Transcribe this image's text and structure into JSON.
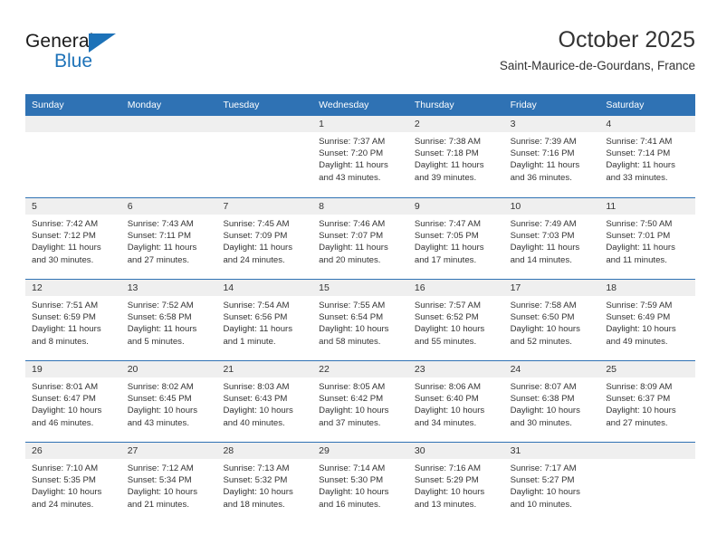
{
  "branding": {
    "name_part1": "General",
    "name_part2": "Blue"
  },
  "header": {
    "title": "October 2025",
    "location": "Saint-Maurice-de-Gourdans, France"
  },
  "weekdays": [
    "Sunday",
    "Monday",
    "Tuesday",
    "Wednesday",
    "Thursday",
    "Friday",
    "Saturday"
  ],
  "colors": {
    "header_blue": "#2f72b4",
    "logo_blue": "#1d72b8",
    "day_band_gray": "#efefef"
  },
  "weeks": [
    [
      {
        "day": "",
        "sunrise": "",
        "sunset": "",
        "daylight_line1": "",
        "daylight_line2": ""
      },
      {
        "day": "",
        "sunrise": "",
        "sunset": "",
        "daylight_line1": "",
        "daylight_line2": ""
      },
      {
        "day": "",
        "sunrise": "",
        "sunset": "",
        "daylight_line1": "",
        "daylight_line2": ""
      },
      {
        "day": "1",
        "sunrise": "Sunrise: 7:37 AM",
        "sunset": "Sunset: 7:20 PM",
        "daylight_line1": "Daylight: 11 hours",
        "daylight_line2": "and 43 minutes."
      },
      {
        "day": "2",
        "sunrise": "Sunrise: 7:38 AM",
        "sunset": "Sunset: 7:18 PM",
        "daylight_line1": "Daylight: 11 hours",
        "daylight_line2": "and 39 minutes."
      },
      {
        "day": "3",
        "sunrise": "Sunrise: 7:39 AM",
        "sunset": "Sunset: 7:16 PM",
        "daylight_line1": "Daylight: 11 hours",
        "daylight_line2": "and 36 minutes."
      },
      {
        "day": "4",
        "sunrise": "Sunrise: 7:41 AM",
        "sunset": "Sunset: 7:14 PM",
        "daylight_line1": "Daylight: 11 hours",
        "daylight_line2": "and 33 minutes."
      }
    ],
    [
      {
        "day": "5",
        "sunrise": "Sunrise: 7:42 AM",
        "sunset": "Sunset: 7:12 PM",
        "daylight_line1": "Daylight: 11 hours",
        "daylight_line2": "and 30 minutes."
      },
      {
        "day": "6",
        "sunrise": "Sunrise: 7:43 AM",
        "sunset": "Sunset: 7:11 PM",
        "daylight_line1": "Daylight: 11 hours",
        "daylight_line2": "and 27 minutes."
      },
      {
        "day": "7",
        "sunrise": "Sunrise: 7:45 AM",
        "sunset": "Sunset: 7:09 PM",
        "daylight_line1": "Daylight: 11 hours",
        "daylight_line2": "and 24 minutes."
      },
      {
        "day": "8",
        "sunrise": "Sunrise: 7:46 AM",
        "sunset": "Sunset: 7:07 PM",
        "daylight_line1": "Daylight: 11 hours",
        "daylight_line2": "and 20 minutes."
      },
      {
        "day": "9",
        "sunrise": "Sunrise: 7:47 AM",
        "sunset": "Sunset: 7:05 PM",
        "daylight_line1": "Daylight: 11 hours",
        "daylight_line2": "and 17 minutes."
      },
      {
        "day": "10",
        "sunrise": "Sunrise: 7:49 AM",
        "sunset": "Sunset: 7:03 PM",
        "daylight_line1": "Daylight: 11 hours",
        "daylight_line2": "and 14 minutes."
      },
      {
        "day": "11",
        "sunrise": "Sunrise: 7:50 AM",
        "sunset": "Sunset: 7:01 PM",
        "daylight_line1": "Daylight: 11 hours",
        "daylight_line2": "and 11 minutes."
      }
    ],
    [
      {
        "day": "12",
        "sunrise": "Sunrise: 7:51 AM",
        "sunset": "Sunset: 6:59 PM",
        "daylight_line1": "Daylight: 11 hours",
        "daylight_line2": "and 8 minutes."
      },
      {
        "day": "13",
        "sunrise": "Sunrise: 7:52 AM",
        "sunset": "Sunset: 6:58 PM",
        "daylight_line1": "Daylight: 11 hours",
        "daylight_line2": "and 5 minutes."
      },
      {
        "day": "14",
        "sunrise": "Sunrise: 7:54 AM",
        "sunset": "Sunset: 6:56 PM",
        "daylight_line1": "Daylight: 11 hours",
        "daylight_line2": "and 1 minute."
      },
      {
        "day": "15",
        "sunrise": "Sunrise: 7:55 AM",
        "sunset": "Sunset: 6:54 PM",
        "daylight_line1": "Daylight: 10 hours",
        "daylight_line2": "and 58 minutes."
      },
      {
        "day": "16",
        "sunrise": "Sunrise: 7:57 AM",
        "sunset": "Sunset: 6:52 PM",
        "daylight_line1": "Daylight: 10 hours",
        "daylight_line2": "and 55 minutes."
      },
      {
        "day": "17",
        "sunrise": "Sunrise: 7:58 AM",
        "sunset": "Sunset: 6:50 PM",
        "daylight_line1": "Daylight: 10 hours",
        "daylight_line2": "and 52 minutes."
      },
      {
        "day": "18",
        "sunrise": "Sunrise: 7:59 AM",
        "sunset": "Sunset: 6:49 PM",
        "daylight_line1": "Daylight: 10 hours",
        "daylight_line2": "and 49 minutes."
      }
    ],
    [
      {
        "day": "19",
        "sunrise": "Sunrise: 8:01 AM",
        "sunset": "Sunset: 6:47 PM",
        "daylight_line1": "Daylight: 10 hours",
        "daylight_line2": "and 46 minutes."
      },
      {
        "day": "20",
        "sunrise": "Sunrise: 8:02 AM",
        "sunset": "Sunset: 6:45 PM",
        "daylight_line1": "Daylight: 10 hours",
        "daylight_line2": "and 43 minutes."
      },
      {
        "day": "21",
        "sunrise": "Sunrise: 8:03 AM",
        "sunset": "Sunset: 6:43 PM",
        "daylight_line1": "Daylight: 10 hours",
        "daylight_line2": "and 40 minutes."
      },
      {
        "day": "22",
        "sunrise": "Sunrise: 8:05 AM",
        "sunset": "Sunset: 6:42 PM",
        "daylight_line1": "Daylight: 10 hours",
        "daylight_line2": "and 37 minutes."
      },
      {
        "day": "23",
        "sunrise": "Sunrise: 8:06 AM",
        "sunset": "Sunset: 6:40 PM",
        "daylight_line1": "Daylight: 10 hours",
        "daylight_line2": "and 34 minutes."
      },
      {
        "day": "24",
        "sunrise": "Sunrise: 8:07 AM",
        "sunset": "Sunset: 6:38 PM",
        "daylight_line1": "Daylight: 10 hours",
        "daylight_line2": "and 30 minutes."
      },
      {
        "day": "25",
        "sunrise": "Sunrise: 8:09 AM",
        "sunset": "Sunset: 6:37 PM",
        "daylight_line1": "Daylight: 10 hours",
        "daylight_line2": "and 27 minutes."
      }
    ],
    [
      {
        "day": "26",
        "sunrise": "Sunrise: 7:10 AM",
        "sunset": "Sunset: 5:35 PM",
        "daylight_line1": "Daylight: 10 hours",
        "daylight_line2": "and 24 minutes."
      },
      {
        "day": "27",
        "sunrise": "Sunrise: 7:12 AM",
        "sunset": "Sunset: 5:34 PM",
        "daylight_line1": "Daylight: 10 hours",
        "daylight_line2": "and 21 minutes."
      },
      {
        "day": "28",
        "sunrise": "Sunrise: 7:13 AM",
        "sunset": "Sunset: 5:32 PM",
        "daylight_line1": "Daylight: 10 hours",
        "daylight_line2": "and 18 minutes."
      },
      {
        "day": "29",
        "sunrise": "Sunrise: 7:14 AM",
        "sunset": "Sunset: 5:30 PM",
        "daylight_line1": "Daylight: 10 hours",
        "daylight_line2": "and 16 minutes."
      },
      {
        "day": "30",
        "sunrise": "Sunrise: 7:16 AM",
        "sunset": "Sunset: 5:29 PM",
        "daylight_line1": "Daylight: 10 hours",
        "daylight_line2": "and 13 minutes."
      },
      {
        "day": "31",
        "sunrise": "Sunrise: 7:17 AM",
        "sunset": "Sunset: 5:27 PM",
        "daylight_line1": "Daylight: 10 hours",
        "daylight_line2": "and 10 minutes."
      },
      {
        "day": "",
        "sunrise": "",
        "sunset": "",
        "daylight_line1": "",
        "daylight_line2": ""
      }
    ]
  ]
}
